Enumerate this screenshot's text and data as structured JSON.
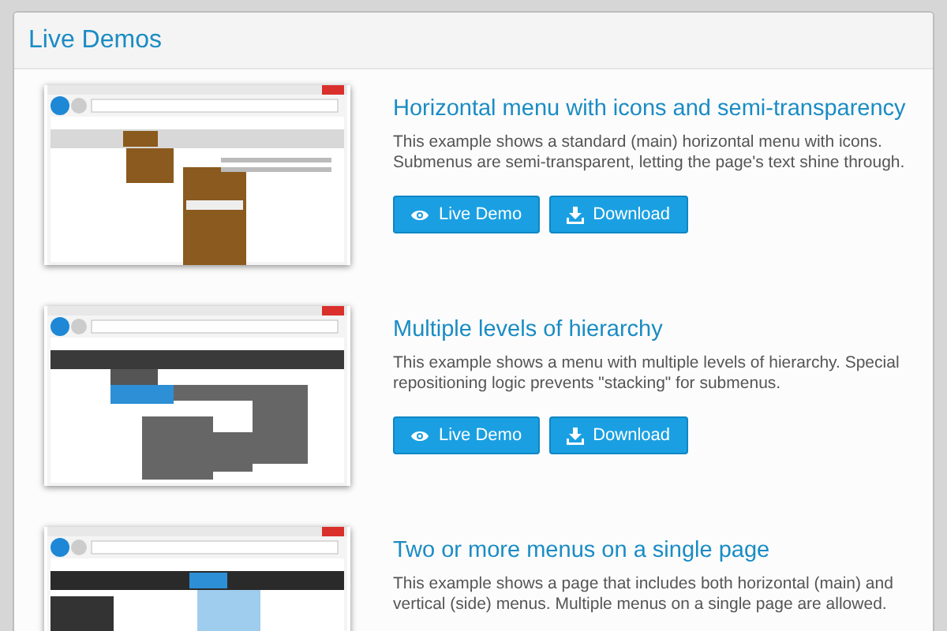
{
  "panel": {
    "title": "Live Demos"
  },
  "demos": [
    {
      "kind": "horizontal",
      "title": "Horizontal menu with icons and semi-transparency",
      "description": "This example shows a standard (main) horizontal menu with icons. Submenus are semi-transparent, letting the page's text shine through.",
      "buttons": [
        "Live Demo",
        "Download"
      ]
    },
    {
      "kind": "multilevel",
      "title": "Multiple levels of hierarchy",
      "description": "This example shows a menu with multiple levels of hierarchy. Special repositioning logic prevents \"stacking\" for submenus.",
      "buttons": [
        "Live Demo",
        "Download"
      ]
    },
    {
      "kind": "multiple",
      "title": "Two or more menus on a single page",
      "description": "This example shows a page that includes both horizontal (main) and vertical (side) menus. Multiple menus on a single page are allowed."
    }
  ]
}
